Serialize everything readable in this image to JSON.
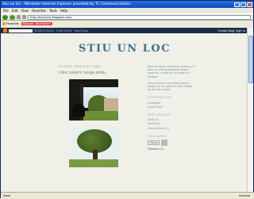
{
  "window": {
    "title": "stiu un loc - Windows Internet Explorer provided by TC Communications"
  },
  "menu": [
    "File",
    "Edit",
    "View",
    "Favorites",
    "Tools",
    "Help"
  ],
  "address": {
    "url": "http://stiuunloc.blogspot.com/"
  },
  "favorites": {
    "item1": "Favorites",
    "item2": "Blogger: Dashboard"
  },
  "navbar": {
    "links": [
      "SEARCH BLOG",
      "FLAG BLOG",
      "Next Blog"
    ],
    "right": [
      "Create Blog",
      "Sign In"
    ]
  },
  "blog": {
    "title": "STIU UN LOC"
  },
  "post": {
    "date": "TUESDAY, MARCH 04, 2008",
    "title": "i like catarni langa atelu"
  },
  "sidebar": {
    "about": "daca ati locuit undeva de unde va-i fi dor s-ar vrea sa povestiti despre acest loc, scrieti-mi cu placere cu trimiteti",
    "about2": "daca sunteti si voi autorul atunci despre un loc scrieti in care credeti ca cel mai frumos",
    "contributors_h": "CONTRIBUTORS",
    "contributors": [
      "Cristopher",
      "Vinnie Pooh"
    ],
    "archive_h": "BLOG ARCHIVE",
    "archive": [
      "2008 (3)",
      "March (3)",
      "Salut prieteni (1)"
    ],
    "followers_h": "FOLLOWERS",
    "follow_label": "Follow",
    "followers_count": "Followers (1)"
  },
  "status": {
    "text": "Done",
    "zone": "Internet"
  }
}
